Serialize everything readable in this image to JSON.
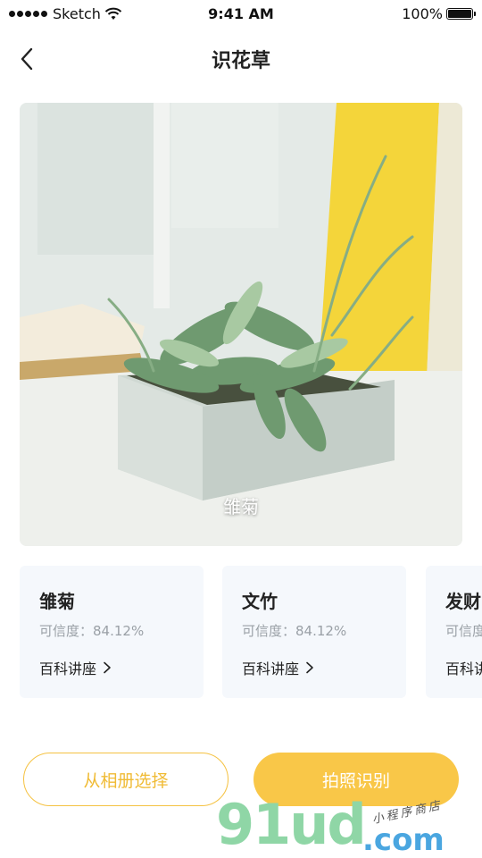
{
  "status_bar": {
    "carrier": "Sketch",
    "time": "9:41 AM",
    "battery": "100%",
    "signal_icon": "signal-dots-icon",
    "wifi_icon": "wifi-icon",
    "battery_icon": "battery-icon"
  },
  "nav": {
    "title": "识花草",
    "back_icon": "chevron-left-icon"
  },
  "hero": {
    "label": "雏菊"
  },
  "results": [
    {
      "name": "雏菊",
      "confidence": "可信度：84.12%",
      "link": "百科讲座"
    },
    {
      "name": "文竹",
      "confidence": "可信度：84.12%",
      "link": "百科讲座"
    },
    {
      "name": "发财",
      "confidence": "可信度",
      "link": "百科讲"
    }
  ],
  "actions": {
    "album_label": "从相册选择",
    "camera_label": "拍照识别"
  },
  "watermark": {
    "main": "91ud",
    "domain": ".com",
    "tagline": "小程序商店"
  },
  "colors": {
    "accent": "#f9c748",
    "accent_text": "#f0bb35",
    "card_bg": "#f5f8fc",
    "muted_text": "#9aa0a6"
  }
}
